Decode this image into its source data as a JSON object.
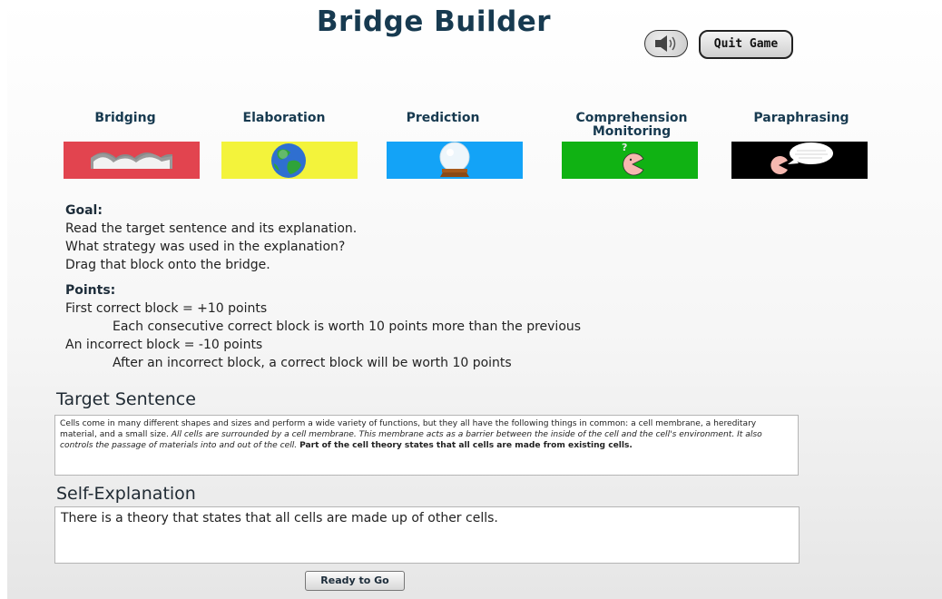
{
  "title": "Bridge Builder",
  "header": {
    "sound_icon": "speaker-icon",
    "quit_label": "Quit Game"
  },
  "strategies": [
    {
      "label": "Bridging",
      "icon": "bridge-icon",
      "color": "#e2444f"
    },
    {
      "label": "Elaboration",
      "icon": "globe-icon",
      "color": "#f3f33b"
    },
    {
      "label": "Prediction",
      "icon": "crystal-ball-icon",
      "color": "#13a3f7"
    },
    {
      "label": "Comprehension Monitoring",
      "label_line1": "Comprehension",
      "label_line2": "Monitoring",
      "icon": "pacman-question-icon",
      "color": "#10b213"
    },
    {
      "label": "Paraphrasing",
      "icon": "speech-bubble-icon",
      "color": "#000000"
    }
  ],
  "instructions": {
    "goal_heading": "Goal:",
    "goal_lines": [
      "Read the target sentence and its explanation.",
      "What strategy was used in the explanation?",
      "Drag that block onto the bridge."
    ],
    "points_heading": "Points:",
    "points_line1": "First correct block = +10 points",
    "points_line2": "Each consecutive correct block is worth 10 points more than the previous",
    "points_line3": "An incorrect block = -10 points",
    "points_line4": "After an incorrect block, a correct block will be worth 10 points"
  },
  "target": {
    "heading": "Target Sentence",
    "plain": "Cells come in many different shapes and sizes and perform a wide variety of functions, but they all have the following things in common: a cell membrane, a hereditary material, and a small size.",
    "italic": "All cells are surrounded by a cell membrane. This membrane acts as a barrier between the inside of the cell and the cell's environment. It also controls the passage of materials into and out of the cell.",
    "bold": "Part of the cell theory states that all cells are made from existing cells."
  },
  "self_explanation": {
    "heading": "Self-Explanation",
    "text": "There is a theory that states that all cells are made up of other cells."
  },
  "ready_label": "Ready to Go"
}
